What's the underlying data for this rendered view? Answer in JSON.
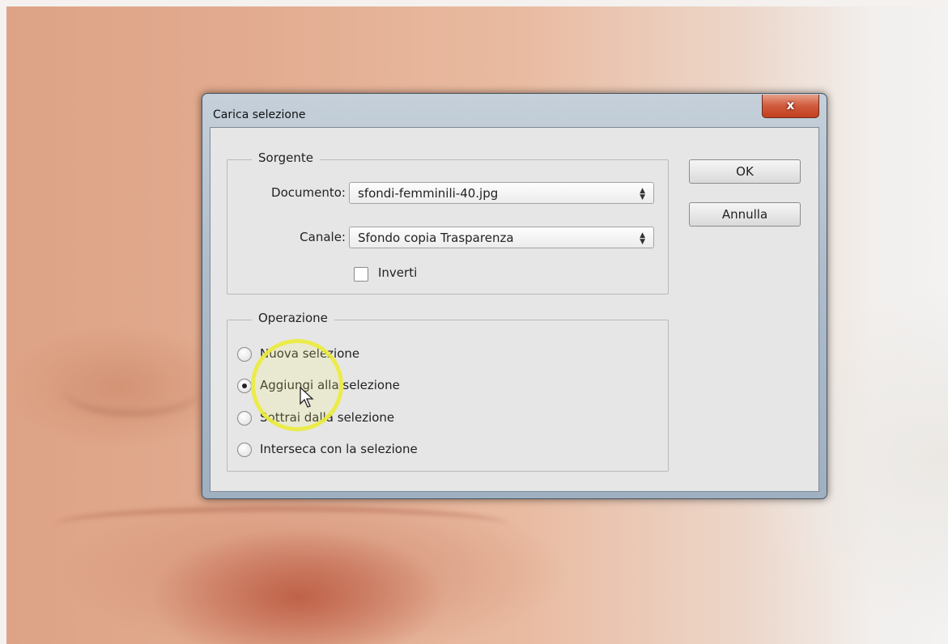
{
  "dialog": {
    "title": "Carica selezione",
    "close_label": "x",
    "source": {
      "legend": "Sorgente",
      "document_label": "Documento:",
      "document_value": "sfondi-femminili-40.jpg",
      "channel_label": "Canale:",
      "channel_value": "Sfondo copia Trasparenza",
      "invert_label": "Inverti",
      "invert_checked": false
    },
    "operation": {
      "legend": "Operazione",
      "options": [
        {
          "label": "Nuova selezione",
          "checked": false
        },
        {
          "label": "Aggiungi alla selezione",
          "checked": true
        },
        {
          "label": "Sottrai dalla selezione",
          "checked": false
        },
        {
          "label": "Interseca con la selezione",
          "checked": false
        }
      ]
    },
    "buttons": {
      "ok": "OK",
      "cancel": "Annulla"
    }
  },
  "icons": {
    "dropdown": "updown-arrows-icon",
    "cursor": "mouse-pointer-icon",
    "close": "close-icon"
  }
}
